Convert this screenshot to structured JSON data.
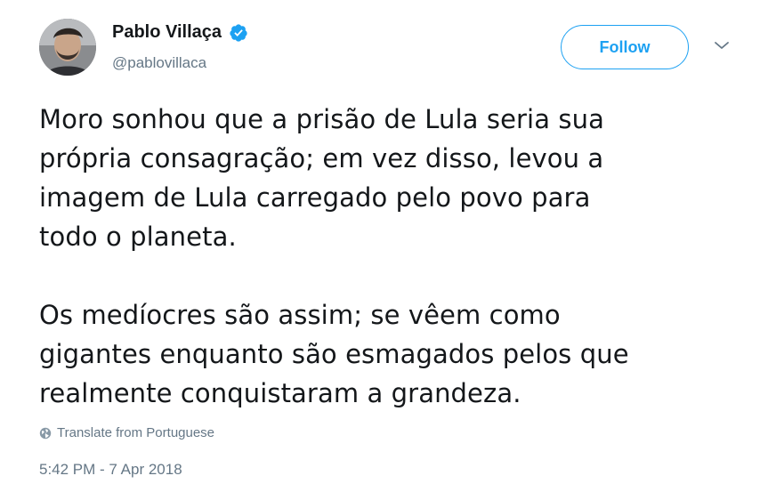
{
  "tweet": {
    "author": {
      "display_name": "Pablo Villaça",
      "handle": "@pablovillaca",
      "verified": true
    },
    "follow_label": "Follow",
    "text_lines": [
      "Moro sonhou que a prisão de Lula seria sua",
      "própria consagração; em vez disso, levou a",
      "imagem de Lula carregado pelo povo para",
      "todo o planeta.",
      "",
      "Os medíocres são assim; se vêem como",
      "gigantes enquanto são esmagados pelos que",
      "realmente conquistaram a grandeza."
    ],
    "translate_label": "Translate from Portuguese",
    "timestamp": "5:42 PM - 7 Apr 2018",
    "colors": {
      "accent": "#1da1f2",
      "text": "#14171a",
      "secondary": "#657786"
    },
    "icons": {
      "verified": "verified-badge-icon",
      "caret": "chevron-down-icon",
      "translate": "globe-icon"
    }
  }
}
